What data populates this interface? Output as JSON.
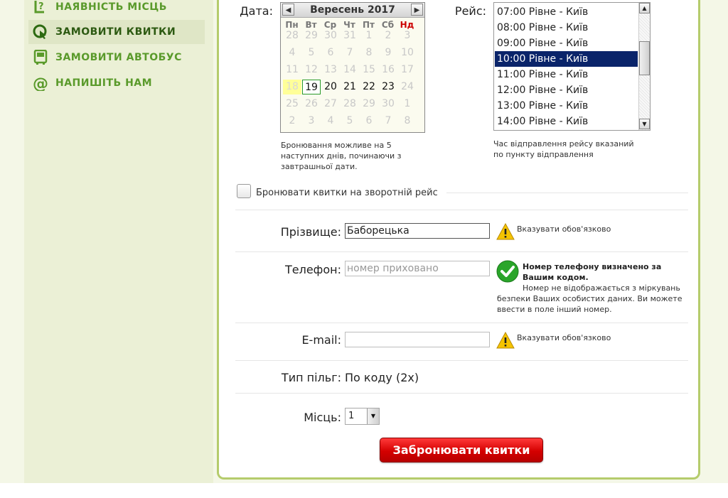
{
  "sidebar": {
    "items": [
      {
        "label": "НАЯВНІСТЬ МІСЦЬ",
        "icon": "seat-question-icon"
      },
      {
        "label": "ЗАМОВИТИ КВИТКИ",
        "icon": "ticket-cursor-icon"
      },
      {
        "label": "ЗАМОВИТИ АВТОБУС",
        "icon": "bus-icon"
      },
      {
        "label": "НАПИШІТЬ НАМ",
        "icon": "at-sign-icon"
      }
    ]
  },
  "form": {
    "date_label": "Дата:",
    "date_hint": [
      "Бронювання можливе на 5",
      "наступних днів, починаючи з",
      "завтрашньої дати."
    ],
    "route_label": "Рейс:",
    "route_hint": [
      "Час відправлення рейсу вказаний",
      "по пункту відправлення"
    ],
    "return_label": "Бронювати квитки на зворотній рейс",
    "surname_label": "Прізвище:",
    "surname_value": "Баборецька",
    "required_hint": "Вказувати обов'язково",
    "phone_label": "Телефон:",
    "phone_placeholder": "номер приховано",
    "phone_hint_bold": [
      "Номер телефону визначено за",
      "Вашим кодом."
    ],
    "phone_hint": [
      "Номер не відображається з міркувань",
      "безпеки Ваших особистих даних. Ви можете",
      "ввести в поле інший номер."
    ],
    "email_label": "E-mail:",
    "email_value": "",
    "benefit_label": "Тип пільг:",
    "benefit_value": "По коду (2х)",
    "seats_label": "Місць:",
    "seats_value": "1",
    "submit_label": "Забронювати квитки"
  },
  "calendar": {
    "month_title": "Вересень 2017",
    "prev": "◀",
    "next": "▶",
    "weekdays": [
      "Пн",
      "Вт",
      "Ср",
      "Чт",
      "Пт",
      "Сб",
      "Нд"
    ],
    "weeks": [
      [
        "28",
        "29",
        "30",
        "31",
        "1",
        "2",
        "3"
      ],
      [
        "4",
        "5",
        "6",
        "7",
        "8",
        "9",
        "10"
      ],
      [
        "11",
        "12",
        "13",
        "14",
        "15",
        "16",
        "17"
      ],
      [
        "18",
        "19",
        "20",
        "21",
        "22",
        "23",
        "24"
      ],
      [
        "25",
        "26",
        "27",
        "28",
        "29",
        "30",
        "1"
      ],
      [
        "2",
        "3",
        "4",
        "5",
        "6",
        "7",
        "8"
      ]
    ],
    "today": "18",
    "selected": "19",
    "bookable": [
      "19",
      "20",
      "21",
      "22",
      "23"
    ]
  },
  "routes": {
    "items": [
      "07:00 Рівне - Київ",
      "08:00 Рівне - Київ",
      "09:00 Рівне - Київ",
      "10:00 Рівне - Київ",
      "11:00 Рівне - Київ",
      "12:00 Рівне - Київ",
      "13:00 Рівне - Київ",
      "14:00 Рівне - Київ"
    ],
    "selected": "10:00 Рівне - Київ",
    "scroll_up": "▲",
    "scroll_down": "▼"
  },
  "colors": {
    "accent_green": "#5a9a2b",
    "border_green": "#b5cc6c",
    "selected_blue": "#0a246a",
    "submit_red": "#d40000"
  }
}
